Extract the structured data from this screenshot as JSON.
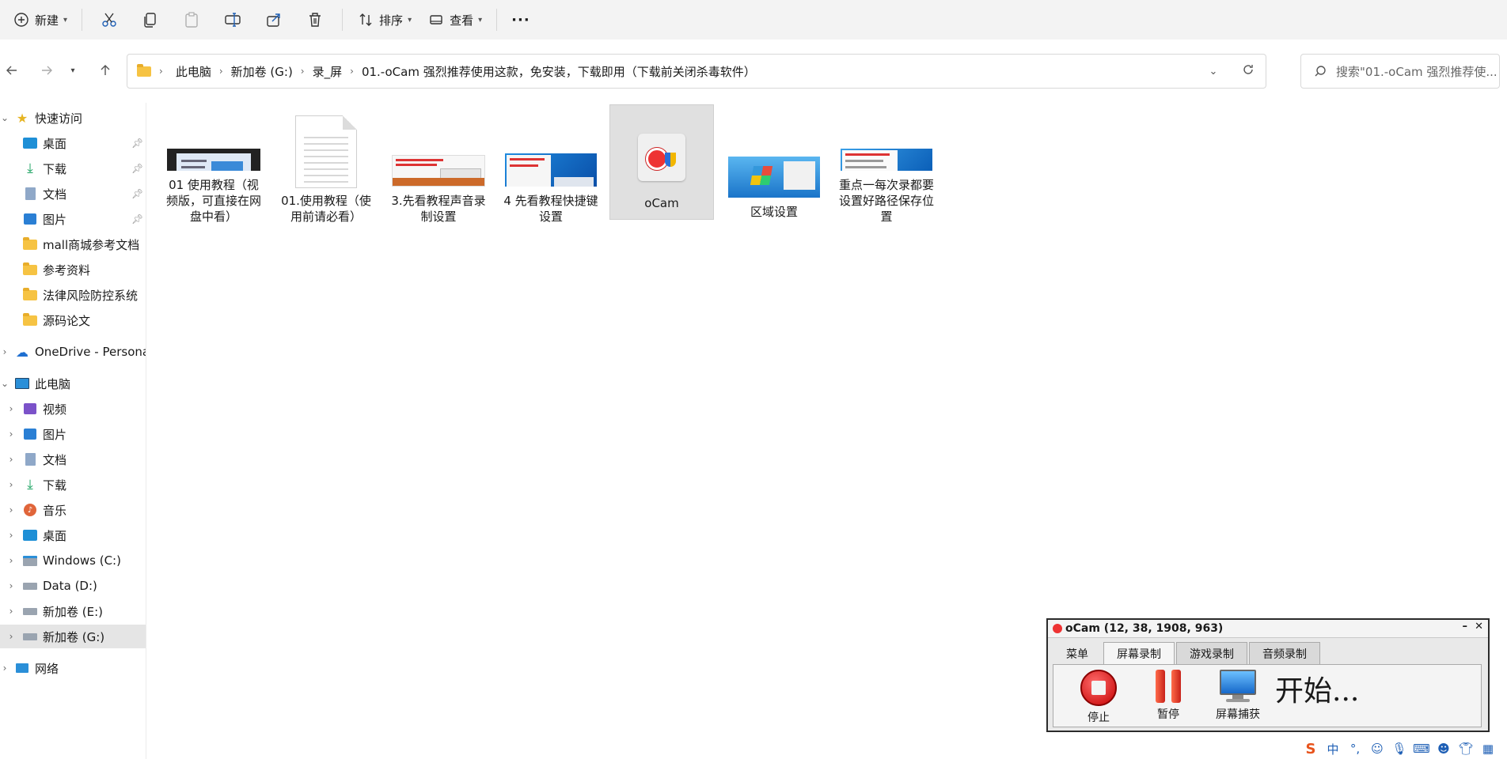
{
  "toolbar": {
    "new_label": "新建",
    "sort_label": "排序",
    "view_label": "查看",
    "more_label": "···"
  },
  "address": {
    "crumbs": [
      "此电脑",
      "新加卷 (G:)",
      "录_屏",
      "01.-oCam 强烈推荐使用这款，免安装，下载即用（下载前关闭杀毒软件）"
    ],
    "search_placeholder": "搜索\"01.-oCam 强烈推荐使..."
  },
  "sidebar": {
    "quick_access": "快速访问",
    "quick_items": [
      "桌面",
      "下载",
      "文档",
      "图片",
      "mall商城参考文档",
      "参考资料",
      "法律风险防控系统",
      "源码论文"
    ],
    "onedrive": "OneDrive - Persona",
    "this_pc": "此电脑",
    "pc_items": [
      "视频",
      "图片",
      "文档",
      "下载",
      "音乐",
      "桌面",
      "Windows (C:)",
      "Data (D:)",
      "新加卷 (E:)",
      "新加卷 (G:)"
    ],
    "network": "网络"
  },
  "files": [
    {
      "name": "01 使用教程（视频版，可直接在网盘中看）"
    },
    {
      "name": "01.使用教程（使用前请必看）"
    },
    {
      "name": "3.先看教程声音录制设置"
    },
    {
      "name": "4 先看教程快捷键设置"
    },
    {
      "name": "oCam"
    },
    {
      "name": "区域设置"
    },
    {
      "name": "重点一每次录都要设置好路径保存位置"
    }
  ],
  "ocam": {
    "title": "oCam (12, 38, 1908, 963)",
    "minimize": "–",
    "close": "✕",
    "tabs": [
      "菜单",
      "屏幕录制",
      "游戏录制",
      "音频录制"
    ],
    "buttons": [
      "停止",
      "暂停",
      "屏幕捕获"
    ],
    "status": "开始..."
  },
  "tray": {
    "ime": "中"
  },
  "colors": {
    "selection": "#e0e0e0",
    "folder": "#f6c343",
    "accent": "#0067c0"
  }
}
